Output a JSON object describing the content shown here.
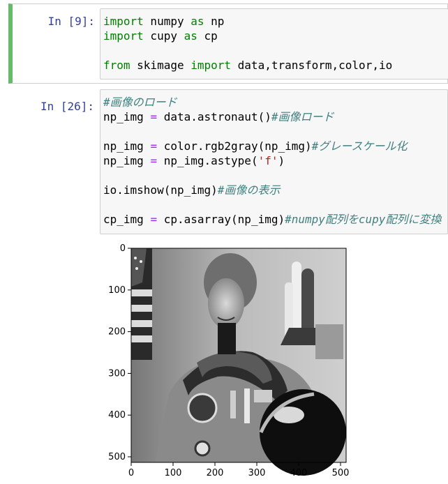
{
  "cell1": {
    "prompt": "In [9]:",
    "lines": [
      [
        {
          "t": "import",
          "c": "kw"
        },
        {
          "t": " numpy ",
          "c": ""
        },
        {
          "t": "as",
          "c": "kw"
        },
        {
          "t": " np",
          "c": ""
        }
      ],
      [
        {
          "t": "import",
          "c": "kw"
        },
        {
          "t": " cupy ",
          "c": ""
        },
        {
          "t": "as",
          "c": "kw"
        },
        {
          "t": " cp",
          "c": ""
        }
      ],
      [],
      [
        {
          "t": "from",
          "c": "kw"
        },
        {
          "t": " skimage ",
          "c": ""
        },
        {
          "t": "import",
          "c": "kw"
        },
        {
          "t": " data,transform,color,io",
          "c": ""
        }
      ]
    ]
  },
  "cell2": {
    "prompt": "In [26]:",
    "lines": [
      [
        {
          "t": "#画像のロード",
          "c": "cm"
        }
      ],
      [
        {
          "t": "np_img ",
          "c": ""
        },
        {
          "t": "=",
          "c": "op"
        },
        {
          "t": " data.astronaut()",
          "c": ""
        },
        {
          "t": "#画像ロード",
          "c": "cm"
        }
      ],
      [],
      [
        {
          "t": "np_img ",
          "c": ""
        },
        {
          "t": "=",
          "c": "op"
        },
        {
          "t": " color.rgb2gray(np_img)",
          "c": ""
        },
        {
          "t": "#グレースケール化",
          "c": "cm"
        }
      ],
      [
        {
          "t": "np_img ",
          "c": ""
        },
        {
          "t": "=",
          "c": "op"
        },
        {
          "t": " np_img.astype(",
          "c": ""
        },
        {
          "t": "'f'",
          "c": "str"
        },
        {
          "t": ")",
          "c": ""
        }
      ],
      [],
      [
        {
          "t": "io.imshow(np_img)",
          "c": ""
        },
        {
          "t": "#画像の表示",
          "c": "cm"
        }
      ],
      [],
      [
        {
          "t": "cp_img ",
          "c": ""
        },
        {
          "t": "=",
          "c": "op"
        },
        {
          "t": " cp.asarray(np_img)",
          "c": ""
        },
        {
          "t": "#numpy配列をcupy配列に変換",
          "c": "cm"
        }
      ]
    ]
  },
  "plot": {
    "y_ticks": [
      "0",
      "100",
      "200",
      "300",
      "400",
      "500"
    ],
    "x_ticks": [
      "0",
      "100",
      "200",
      "300",
      "400",
      "500"
    ]
  }
}
